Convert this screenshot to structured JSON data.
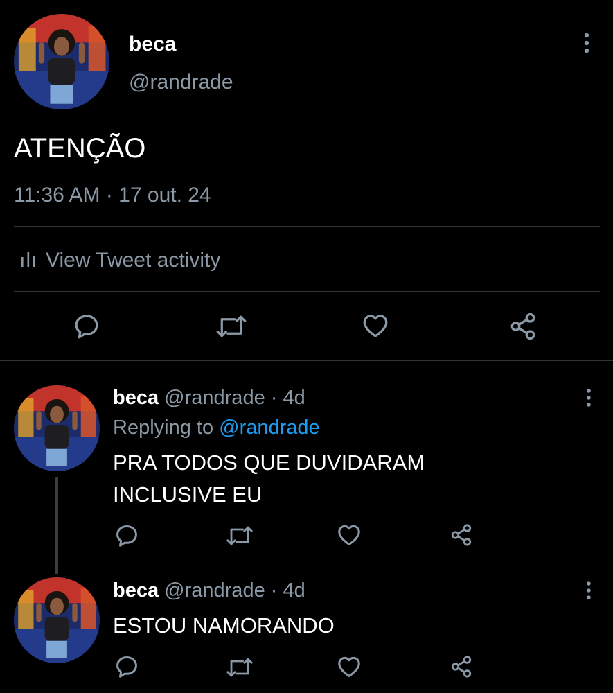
{
  "main_tweet": {
    "name": "beca",
    "handle": "@randrade",
    "text": "ATENÇÃO",
    "timestamp": "11:36 AM · 17 out. 24",
    "activity_label": "View Tweet activity"
  },
  "replies": [
    {
      "name": "beca",
      "meta": "@randrade · 4d",
      "replying_prefix": "Replying to",
      "replying_handle": "@randrade",
      "text_lines": [
        "PRA TODOS QUE DUVIDARAM",
        "INCLUSIVE EU"
      ]
    },
    {
      "name": "beca",
      "meta": "@randrade · 4d",
      "text_lines": [
        "ESTOU NAMORANDO"
      ]
    }
  ],
  "icons": {
    "more": "more-vertical-icon",
    "activity": "bar-chart-icon",
    "reply": "comment-icon",
    "retweet": "retweet-icon",
    "like": "heart-icon",
    "share": "share-icon"
  },
  "colors": {
    "background": "#000000",
    "text": "#ffffff",
    "muted": "#8b98a5",
    "link": "#1d9bf0",
    "divider": "#2f3336"
  }
}
